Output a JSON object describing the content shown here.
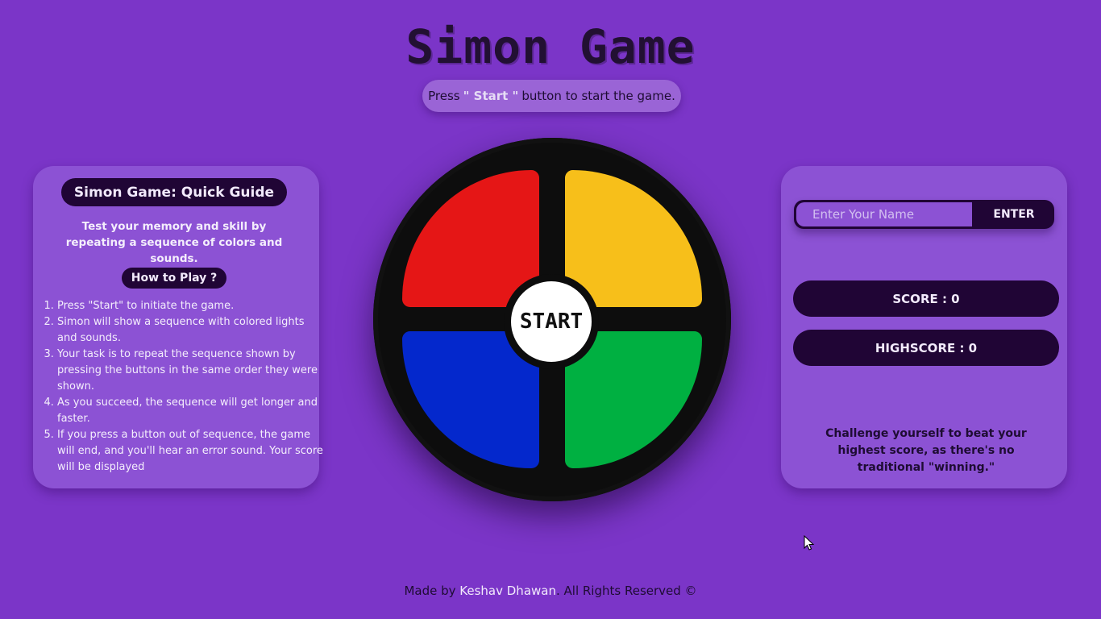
{
  "title": "Simon Game",
  "status": {
    "prefix": "Press",
    "highlight": "\" Start \"",
    "suffix": "button to start the game."
  },
  "guide": {
    "title": "Simon Game: Quick Guide",
    "description": "Test your memory and skill by repeating a sequence of colors and sounds.",
    "how_to_title": "How to Play ?",
    "steps": [
      "Press \"Start\" to initiate the game.",
      "Simon will show a sequence with colored lights and sounds.",
      "Your task is to repeat the sequence shown by pressing the buttons in the same order they were shown.",
      "As you succeed, the sequence will get longer and faster.",
      "If you press a button out of sequence, the game will end, and you'll hear an error sound. Your score will be displayed"
    ]
  },
  "board": {
    "start_label": "START",
    "colors": {
      "red": "#e51616",
      "yellow": "#f7bf1a",
      "blue": "#0428cc",
      "green": "#00b041"
    }
  },
  "player": {
    "name_placeholder": "Enter Your Name",
    "name_value": "",
    "enter_label": "ENTER",
    "score_label": "SCORE : 0",
    "highscore_label": "HIGHSCORE : 0",
    "challenge_text": "Challenge yourself to beat your highest score, as there's no traditional \"winning.\""
  },
  "footer": {
    "prefix": "Made by",
    "author": "Keshav Dhawan",
    "suffix": ". All Rights Reserved ©"
  },
  "theme": {
    "background": "#7b35c8",
    "panel": "#8c52d4",
    "dark": "#200535"
  }
}
